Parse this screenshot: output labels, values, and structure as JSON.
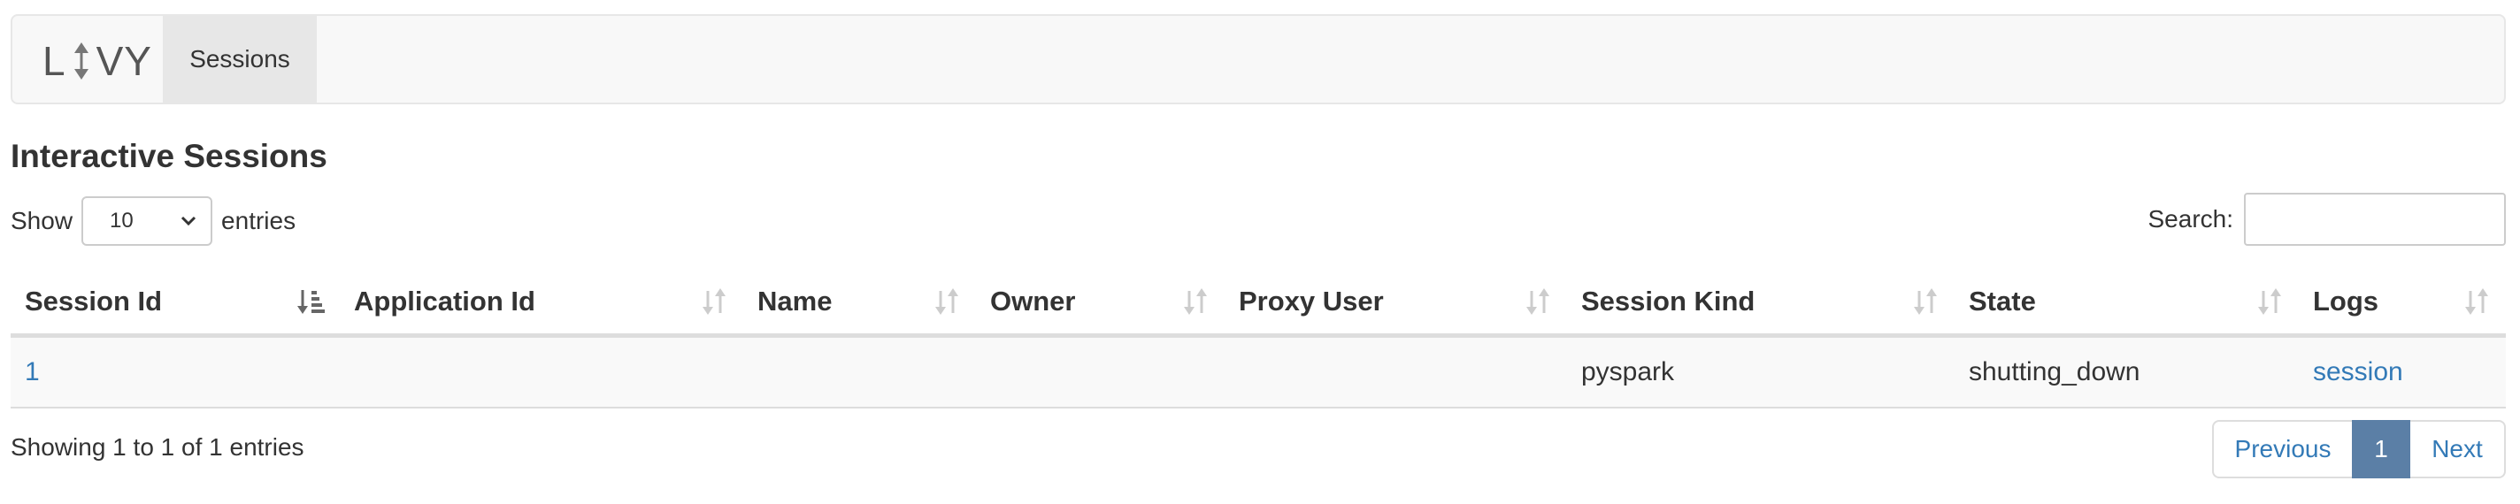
{
  "navbar": {
    "brand_left": "L",
    "brand_right": "VY",
    "tabs": [
      {
        "label": "Sessions"
      }
    ]
  },
  "page": {
    "title": "Interactive Sessions"
  },
  "length_menu": {
    "show_label": "Show",
    "selected": "10",
    "entries_label": "entries"
  },
  "search": {
    "label": "Search:",
    "value": "",
    "placeholder": ""
  },
  "table": {
    "columns": [
      "Session Id",
      "Application Id",
      "Name",
      "Owner",
      "Proxy User",
      "Session Kind",
      "State",
      "Logs"
    ],
    "sorted_column": "Session Id",
    "rows": [
      {
        "session_id": "1",
        "application_id": "",
        "name": "",
        "owner": "",
        "proxy_user": "",
        "session_kind": "pyspark",
        "state": "shutting_down",
        "logs": "session"
      }
    ]
  },
  "info": "Showing 1 to 1 of 1 entries",
  "pagination": {
    "previous": "Previous",
    "current": "1",
    "next": "Next"
  },
  "colors": {
    "link": "#337ab7",
    "active_page": "#5b7fa6",
    "navbar_bg": "#f8f8f8",
    "active_tab_bg": "#e7e7e7"
  }
}
